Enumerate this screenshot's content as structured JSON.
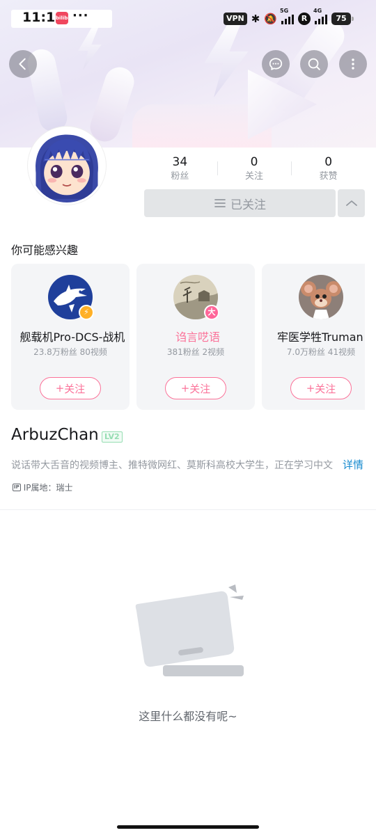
{
  "status_bar": {
    "time": "11:11",
    "app_badge": "bilibili",
    "dots": "···",
    "vpn": "VPN",
    "signal1_label": "5G",
    "signal2_label": "4G",
    "r_badge": "R",
    "battery": "75"
  },
  "profile": {
    "stats": [
      {
        "value": "34",
        "label": "粉丝"
      },
      {
        "value": "0",
        "label": "关注"
      },
      {
        "value": "0",
        "label": "获赞"
      }
    ],
    "followed_button": "已关注"
  },
  "recommendations": {
    "title": "你可能感兴趣",
    "cards": [
      {
        "name": "舰载机Pro-DCS-战机",
        "meta": "23.8万粉丝  80视频",
        "follow": "关注",
        "badge": "⚡"
      },
      {
        "name": "诌言呓语",
        "meta": "381粉丝  2视频",
        "follow": "关注",
        "badge": "大"
      },
      {
        "name": "牢医学牲Truman",
        "meta": "7.0万粉丝  41视频",
        "follow": "关注",
        "badge": ""
      }
    ]
  },
  "user": {
    "name": "ArbuzChan",
    "level": "LV2",
    "bio": "说话带大舌音的视频博主、推特微网红、莫斯科高校大学生，正在学习中文",
    "detail_link": "详情",
    "ip_icon": "IP",
    "ip_text": "IP属地：瑞士"
  },
  "empty_state": {
    "text": "这里什么都没有呢~"
  },
  "colors": {
    "accent_pink": "#fb7299",
    "link_blue": "#178bcf",
    "level_green": "#95ddb2"
  }
}
